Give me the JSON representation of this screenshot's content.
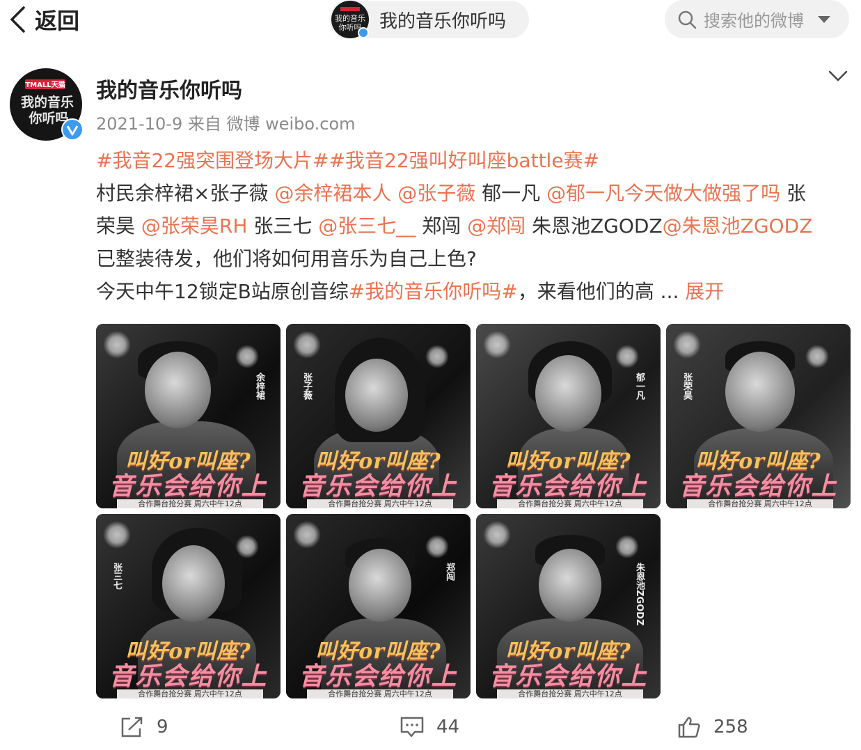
{
  "nav": {
    "back_label": "返回",
    "page_title": "我的音乐你听吗",
    "search_placeholder": "搜索他的微博"
  },
  "post": {
    "author": "我的音乐你听吗",
    "date": "2021-10-9",
    "source": "来自 微博 weibo.com",
    "text_lines": [
      [
        {
          "t": "#我音22强突围登场大片#",
          "link": true
        },
        {
          "t": "#我音22强叫好叫座battle赛#",
          "link": true
        }
      ],
      [
        {
          "t": "村民余梓裙×张子薇 ",
          "link": false
        },
        {
          "t": "@余梓裙本人",
          "link": true
        },
        {
          "t": " ",
          "link": false
        },
        {
          "t": "@张子薇",
          "link": true
        },
        {
          "t": " 郁一凡 ",
          "link": false
        },
        {
          "t": "@郁一凡今天做大做强了吗",
          "link": true
        },
        {
          "t": " 张",
          "link": false
        }
      ],
      [
        {
          "t": "荣昊 ",
          "link": false
        },
        {
          "t": "@张荣昊RH",
          "link": true
        },
        {
          "t": " 张三七 ",
          "link": false
        },
        {
          "t": "@张三七__",
          "link": true
        },
        {
          "t": " 郑闯 ",
          "link": false
        },
        {
          "t": "@郑闯",
          "link": true
        },
        {
          "t": " 朱恩池ZGODZ",
          "link": false
        },
        {
          "t": "@朱恩池ZGODZ",
          "link": true
        }
      ],
      [
        {
          "t": "已整装待发，他们将如何用音乐为自己上色?",
          "link": false
        }
      ],
      [
        {
          "t": "今天中午12锁定B站原创音综",
          "link": false
        },
        {
          "t": "#我的音乐你听吗#",
          "link": true
        },
        {
          "t": "，来看他们的高 ...",
          "link": false
        },
        {
          "t": "  展开",
          "link": true
        }
      ]
    ],
    "images": [
      {
        "name": "余梓裙",
        "caption_top": "叫好or叫座?",
        "caption_main": "音乐会给你上色",
        "caption_bottom": "合作舞台抢分赛 周六中午12点"
      },
      {
        "name": "张子薇",
        "caption_top": "叫好or叫座?",
        "caption_main": "音乐会给你上色",
        "caption_bottom": "合作舞台抢分赛 周六中午12点"
      },
      {
        "name": "郁一凡",
        "caption_top": "叫好or叫座?",
        "caption_main": "音乐会给你上色",
        "caption_bottom": "合作舞台抢分赛 周六中午12点"
      },
      {
        "name": "张荣昊",
        "caption_top": "叫好or叫座?",
        "caption_main": "音乐会给你上色",
        "caption_bottom": "合作舞台抢分赛 周六中午12点"
      },
      {
        "name": "张三七",
        "caption_top": "叫好or叫座?",
        "caption_main": "音乐会给你上色",
        "caption_bottom": "合作舞台抢分赛 周六中午12点"
      },
      {
        "name": "郑闯",
        "caption_top": "叫好or叫座?",
        "caption_main": "音乐会给你上色",
        "caption_bottom": "合作舞台抢分赛 周六中午12点"
      },
      {
        "name": "朱恩池ZGODZ",
        "caption_top": "叫好or叫座?",
        "caption_main": "音乐会给你上色",
        "caption_bottom": "合作舞台抢分赛 周六中午12点"
      }
    ],
    "logo_text": "TMALL天猫 我的音乐你听吗"
  },
  "actions": {
    "repost_count": "9",
    "comment_count": "44",
    "like_count": "258"
  },
  "colors": {
    "link": "#eb7350",
    "verified": "#3a9bf0",
    "pill_bg": "#f1f1f1"
  },
  "icons": [
    "back-chevron-icon",
    "search-icon",
    "dropdown-caret-icon",
    "verified-icon",
    "chevron-down-icon",
    "repost-icon",
    "comment-icon",
    "like-icon"
  ]
}
